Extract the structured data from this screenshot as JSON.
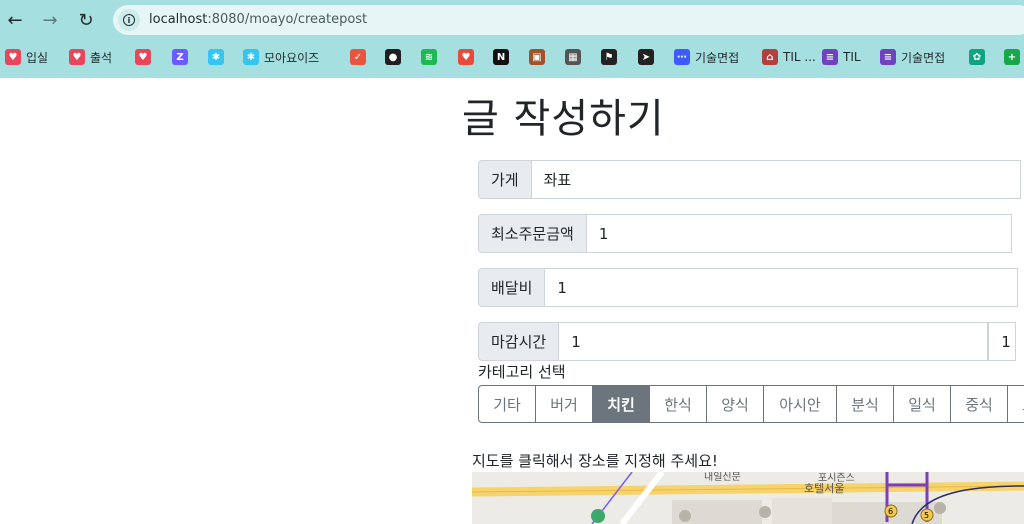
{
  "browser": {
    "url_host": "localhost",
    "url_rest": ":8080/moayo/createpost",
    "bookmarks": [
      {
        "label": "입실",
        "icon": "heart-chat-icon",
        "color": "#e8465a"
      },
      {
        "label": "출석",
        "icon": "heart-chat-icon",
        "color": "#e8465a"
      },
      {
        "label": "",
        "icon": "heart-chat-icon",
        "color": "#e8465a"
      },
      {
        "label": "",
        "icon": "zep-icon",
        "color": "#6a5cff"
      },
      {
        "label": "",
        "icon": "slack-icon",
        "color": "#36c5f0"
      },
      {
        "label": "모아요이즈",
        "icon": "slack-icon",
        "color": "#36c5f0"
      },
      {
        "label": "",
        "icon": "todo-icon",
        "color": "#e8553e"
      },
      {
        "label": "",
        "icon": "github-icon",
        "color": "#1f1f1f"
      },
      {
        "label": "",
        "icon": "spotify-icon",
        "color": "#1db954"
      },
      {
        "label": "",
        "icon": "heart-fire-icon",
        "color": "#e84b3c"
      },
      {
        "label": "",
        "icon": "notion-icon",
        "color": "#111111"
      },
      {
        "label": "",
        "icon": "briefcase-icon",
        "color": "#a0522d"
      },
      {
        "label": "",
        "icon": "grid-icon",
        "color": "#555555"
      },
      {
        "label": "",
        "icon": "checkered-flag-icon",
        "color": "#222222"
      },
      {
        "label": "",
        "icon": "send-icon",
        "color": "#222222"
      },
      {
        "label": "기술면접",
        "icon": "dots-icon",
        "color": "#3d5afe"
      },
      {
        "label": "TIL ...",
        "icon": "bridge-icon",
        "color": "#b0413e"
      },
      {
        "label": "TIL",
        "icon": "list-icon",
        "color": "#6f42c1"
      },
      {
        "label": "기술면접",
        "icon": "list-icon",
        "color": "#6f42c1"
      },
      {
        "label": "",
        "icon": "openai-icon",
        "color": "#10a37f"
      },
      {
        "label": "",
        "icon": "plus-icon",
        "color": "#1aa64b"
      }
    ]
  },
  "page": {
    "title": "글 작성하기",
    "fields": [
      {
        "label": "가게",
        "value": "좌표"
      },
      {
        "label": "최소주문금액",
        "value": "1"
      },
      {
        "label": "배달비",
        "value": "1"
      },
      {
        "label": "마감시간",
        "value": "1",
        "extra_value": "1"
      }
    ],
    "category_label": "카테고리 선택",
    "categories": [
      "기타",
      "버거",
      "치킨",
      "한식",
      "양식",
      "아시안",
      "분식",
      "일식",
      "중식",
      "도"
    ],
    "selected_category": "치킨",
    "map_hint": "지도를 클릭해서 장소를 지정해 주세요!",
    "map_labels": [
      "내일신문",
      "포시즌스",
      "호텔서울",
      "6",
      "5"
    ]
  }
}
